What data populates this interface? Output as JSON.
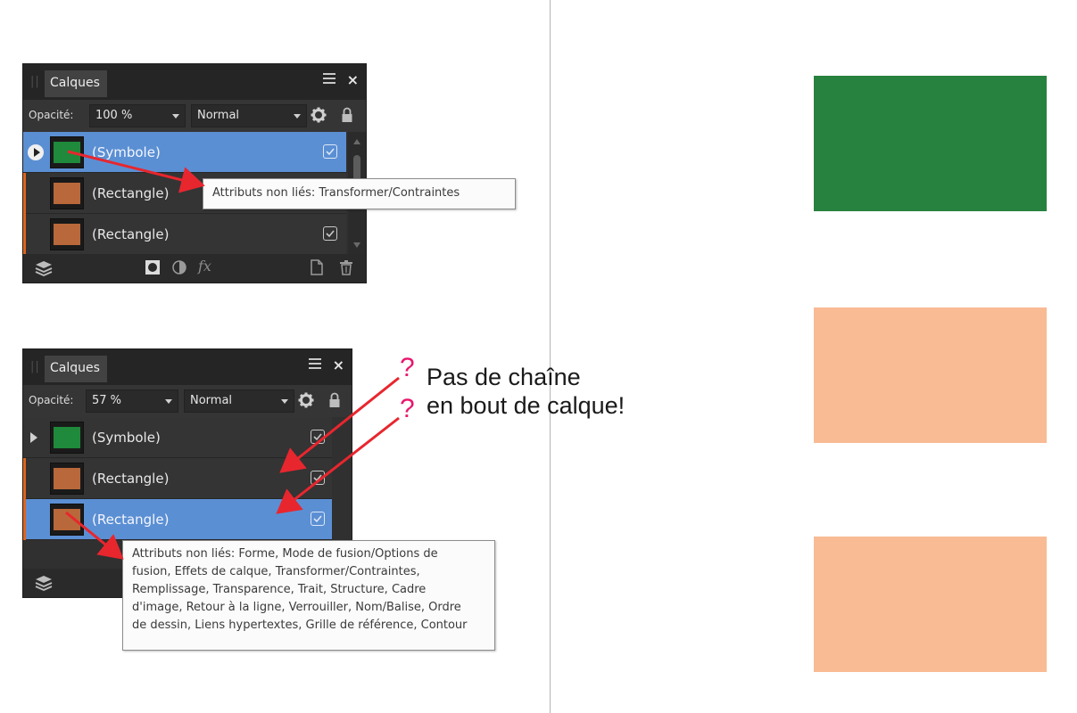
{
  "panels": [
    {
      "tab_label": "Calques",
      "opacity_label": "Opacité:",
      "opacity_value": "100 %",
      "blend_mode": "Normal",
      "layers": [
        {
          "label": "(Symbole)",
          "thumb_color": "#1f8a3b",
          "selected": true,
          "visible": true
        },
        {
          "label": "(Rectangle)",
          "thumb_color": "#b8683a",
          "selected": false,
          "visible": true
        },
        {
          "label": "(Rectangle)",
          "thumb_color": "#b8683a",
          "selected": false,
          "visible": true
        }
      ],
      "tooltip": "Attributs non liés: Transformer/Contraintes"
    },
    {
      "tab_label": "Calques",
      "opacity_label": "Opacité:",
      "opacity_value": "57 %",
      "blend_mode": "Normal",
      "layers": [
        {
          "label": "(Symbole)",
          "thumb_color": "#1f8a3b",
          "selected": false,
          "visible": true
        },
        {
          "label": "(Rectangle)",
          "thumb_color": "#b8683a",
          "selected": false,
          "visible": true
        },
        {
          "label": "(Rectangle)",
          "thumb_color": "#b8683a",
          "selected": true,
          "visible": true
        }
      ],
      "tooltip_lines": [
        "Attributs non liés: Forme, Mode de fusion/Options de",
        "fusion, Effets de calque, Transformer/Contraintes,",
        "Remplissage, Transparence, Trait, Structure, Cadre",
        "d'image, Retour à la ligne, Verrouiller, Nom/Balise, Ordre",
        "de dessin, Liens hypertextes, Grille de référence, Contour"
      ]
    }
  ],
  "annotation": {
    "marker": "?",
    "line1": "Pas de chaîne",
    "line2": "en bout de calque!",
    "marker_color": "#e8176c",
    "arrow_color": "#e8262e"
  },
  "canvas_shapes": [
    {
      "color": "#27813f"
    },
    {
      "color": "#f8bb94"
    },
    {
      "color": "#f8bb94"
    }
  ]
}
